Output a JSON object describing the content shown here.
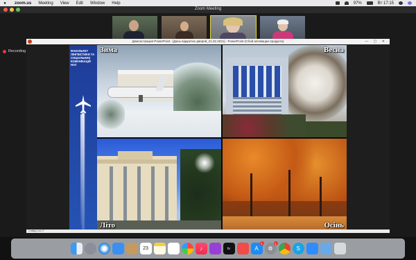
{
  "menubar": {
    "app": "zoom.us",
    "items": [
      "Meeting",
      "View",
      "Edit",
      "Window",
      "Help"
    ],
    "battery": "97%",
    "time": "Вт 17:15"
  },
  "zoom": {
    "title": "Zoom Meeting",
    "recording": "Recording"
  },
  "powerpoint": {
    "window_title": "Демонстрация PowerPoint - [День відкритих дверей_21.02.2021] - PowerPoint (Сбой активации продукта)",
    "status": "Слайд 1 из 17"
  },
  "slide": {
    "sidebar_text": "Факультет лінгвістики та соціальних комунікацій НАУ",
    "seasons": [
      "Зима",
      "Весна",
      "Літо",
      "Осінь"
    ]
  },
  "dock": {
    "icons": [
      "finder-icon",
      "launchpad-icon",
      "safari-icon",
      "mail-icon",
      "contacts-icon",
      "calendar-icon",
      "notes-icon",
      "reminders-icon",
      "music-icon",
      "podcasts-icon",
      "tv-icon",
      "news-icon",
      "photos-icon",
      "appstore-icon",
      "system-preferences-icon",
      "chrome-icon",
      "skype-icon",
      "zoom-icon",
      "downloads-icon",
      "trash-icon"
    ],
    "calendar_day": "23",
    "badge_appstore": "1",
    "badge_sysprefs": "1"
  }
}
